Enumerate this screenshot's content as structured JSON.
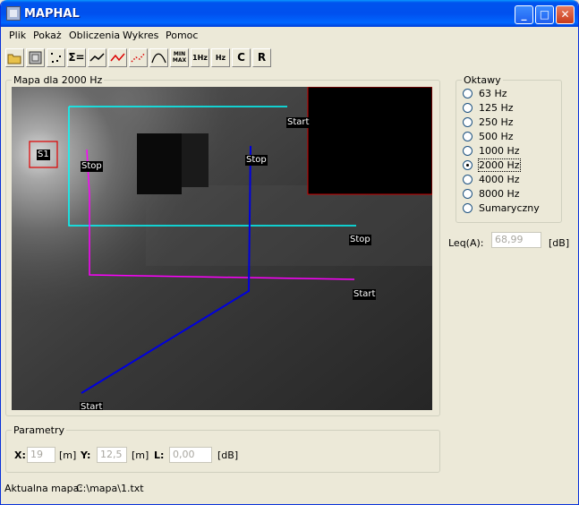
{
  "window": {
    "title": "MAPHAL"
  },
  "menu": [
    "Plik",
    "Pokaż",
    "Obliczenia",
    "Wykres",
    "Pomoc"
  ],
  "toolbar": [
    {
      "icon": "open-folder-icon",
      "label": ""
    },
    {
      "icon": "frame-icon",
      "label": ""
    },
    {
      "icon": "points-icon",
      "label": ""
    },
    {
      "icon": "sigma-icon",
      "label": "Σ="
    },
    {
      "icon": "line-chart-icon",
      "label": ""
    },
    {
      "icon": "red-line-chart-icon",
      "label": ""
    },
    {
      "icon": "dotted-chart-icon",
      "label": ""
    },
    {
      "icon": "curve-icon",
      "label": ""
    },
    {
      "icon": "min-max-icon",
      "label": "MIN MAX"
    },
    {
      "icon": "one-hz-icon",
      "label": "1Hz"
    },
    {
      "icon": "hz-icon",
      "label": "Hz"
    },
    {
      "icon": "c-icon",
      "label": "C"
    },
    {
      "icon": "r-icon",
      "label": "R"
    }
  ],
  "map_group": {
    "title": "Mapa dla 2000 Hz"
  },
  "map_labels": {
    "s1": "S1",
    "cyan_start": "Start",
    "cyan_stop": "Stop",
    "magenta_stop": "Stop",
    "magenta_start": "Start",
    "blue_stop": "Stop",
    "blue_start": "Start"
  },
  "route_colors": {
    "cyan": "#00ffff",
    "magenta": "#ff00ff",
    "blue": "#0000ff"
  },
  "octaves": {
    "title": "Oktawy",
    "options": [
      "63 Hz",
      "125 Hz",
      "250 Hz",
      "500 Hz",
      "1000 Hz",
      "2000 Hz",
      "4000 Hz",
      "8000 Hz",
      "Sumaryczny"
    ],
    "selected": "2000 Hz"
  },
  "leq": {
    "label": "Leq(A):",
    "value": "68,99",
    "unit": "[dB]"
  },
  "parametry": {
    "title": "Parametry",
    "x_label": "X:",
    "x_value": "19",
    "x_unit": "[m]",
    "y_label": "Y:",
    "y_value": "12,5",
    "y_unit": "[m]",
    "l_label": "L:",
    "l_value": "0,00",
    "l_unit": "[dB]"
  },
  "status": {
    "label": "Aktualna mapa:",
    "path": "C:\\mapa\\1.txt"
  }
}
